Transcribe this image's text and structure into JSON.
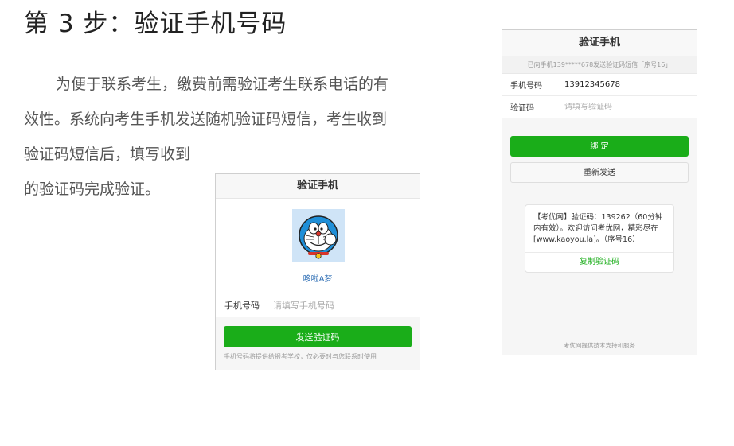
{
  "step": {
    "title": "第 3 步：验证手机号码",
    "paragraph_lines": [
      "为便于联系考生，缴费前需验证考生联系电话的有",
      "效性。系统向考生手机发送随机验证码短信，考生收到",
      "验证码短信后，填写收到",
      "的验证码完成验证。"
    ]
  },
  "panel_a": {
    "header": "验证手机",
    "nickname": "哆啦A梦",
    "avatar_icon": "doraemon-avatar",
    "phone_label": "手机号码",
    "phone_placeholder": "请填写手机号码",
    "send_button": "发送验证码",
    "note": "手机号码将提供给报考学校，仅必要时与您联系时使用"
  },
  "panel_b": {
    "header": "验证手机",
    "sent_notice": "已向手机139*****678发送验证码短信「序号16」",
    "phone_label": "手机号码",
    "phone_value": "13912345678",
    "code_label": "验证码",
    "code_placeholder": "请填写验证码",
    "bind_button": "绑 定",
    "resend_button": "重新发送",
    "sms_text": "【考优网】验证码：139262（60分钟内有效）。欢迎访问考优网，精彩尽在[www.kaoyou.la]。（序号16）",
    "copy_button": "复制验证码",
    "footer": "考优网提供技术支持和服务"
  },
  "colors": {
    "accent_green": "#1aad19",
    "link_blue": "#2f6fb5",
    "avatar_bg": "#cfe4f7"
  }
}
